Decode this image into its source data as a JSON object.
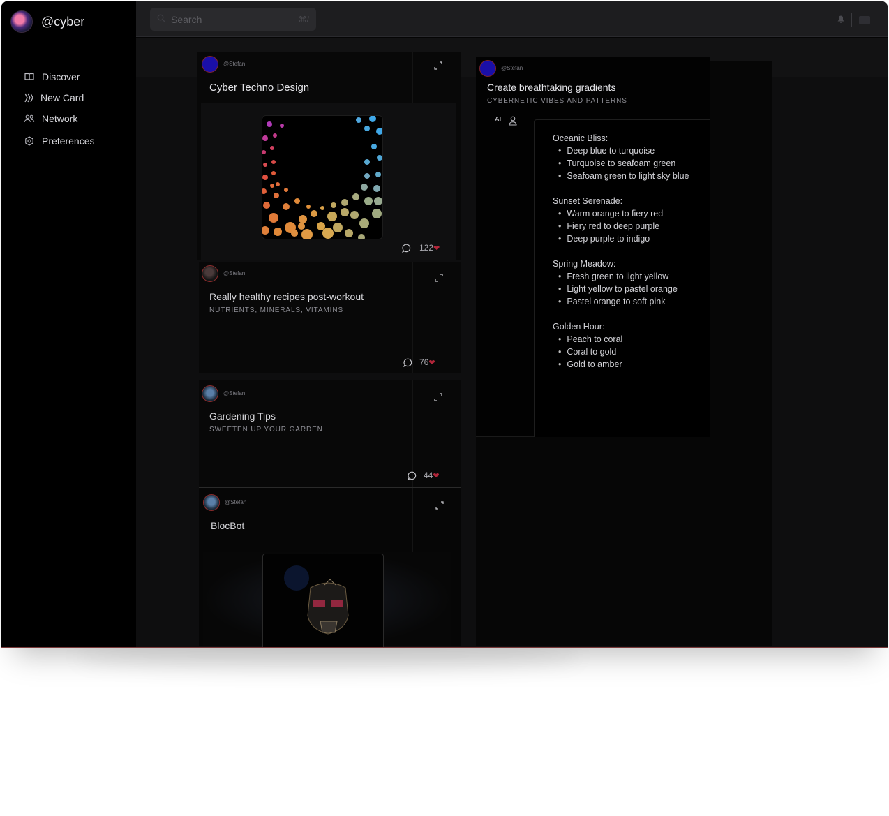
{
  "app": {
    "handle": "@cyber"
  },
  "sidebar": {
    "items": [
      {
        "label": "Discover",
        "icon": "book-icon"
      },
      {
        "label": "New Card",
        "icon": "new-card-icon"
      },
      {
        "label": "Network",
        "icon": "users-icon"
      },
      {
        "label": "Preferences",
        "icon": "settings-hexagon-icon"
      }
    ]
  },
  "search": {
    "placeholder": "Search",
    "shortcut": "⌘/"
  },
  "feed": {
    "cards": [
      {
        "user": "@Stefan",
        "title": "Cyber Techno Design",
        "subtitle": "",
        "comments_icon": "comment-icon",
        "likes": "122"
      },
      {
        "user": "@Stefan",
        "title": "Really healthy recipes post-workout",
        "subtitle": "NUTRIENTS, MINERALS, VITAMINS",
        "likes": "76"
      },
      {
        "user": "@Stefan",
        "title": "Gardening Tips",
        "subtitle": "SWEETEN UP YOUR GARDEN",
        "likes": "44"
      },
      {
        "user": "@Stefan",
        "title": "BlocBot",
        "subtitle": ""
      }
    ]
  },
  "detail": {
    "user": "@Stefan",
    "title": "Create breathtaking gradients",
    "subtitle": "CYBERNETIC VIBES AND PATTERNS",
    "ai_label": "AI",
    "groups": [
      {
        "name": "Oceanic Bliss:",
        "items": [
          "Deep blue to turquoise",
          "Turquoise to seafoam green",
          "Seafoam green to light sky blue"
        ]
      },
      {
        "name": "Sunset Serenade:",
        "items": [
          "Warm orange to fiery red",
          "Fiery red to deep purple",
          "Deep purple to indigo"
        ]
      },
      {
        "name": "Spring Meadow:",
        "items": [
          "Fresh green to light yellow",
          "Light yellow to pastel orange",
          "Pastel orange to soft pink"
        ]
      },
      {
        "name": "Golden Hour:",
        "items": [
          "Peach to coral",
          "Coral to gold",
          "Gold to amber"
        ]
      }
    ]
  },
  "colors": {
    "accent_heart": "#b3263a",
    "avatar_ring": "#8b2c2c"
  }
}
